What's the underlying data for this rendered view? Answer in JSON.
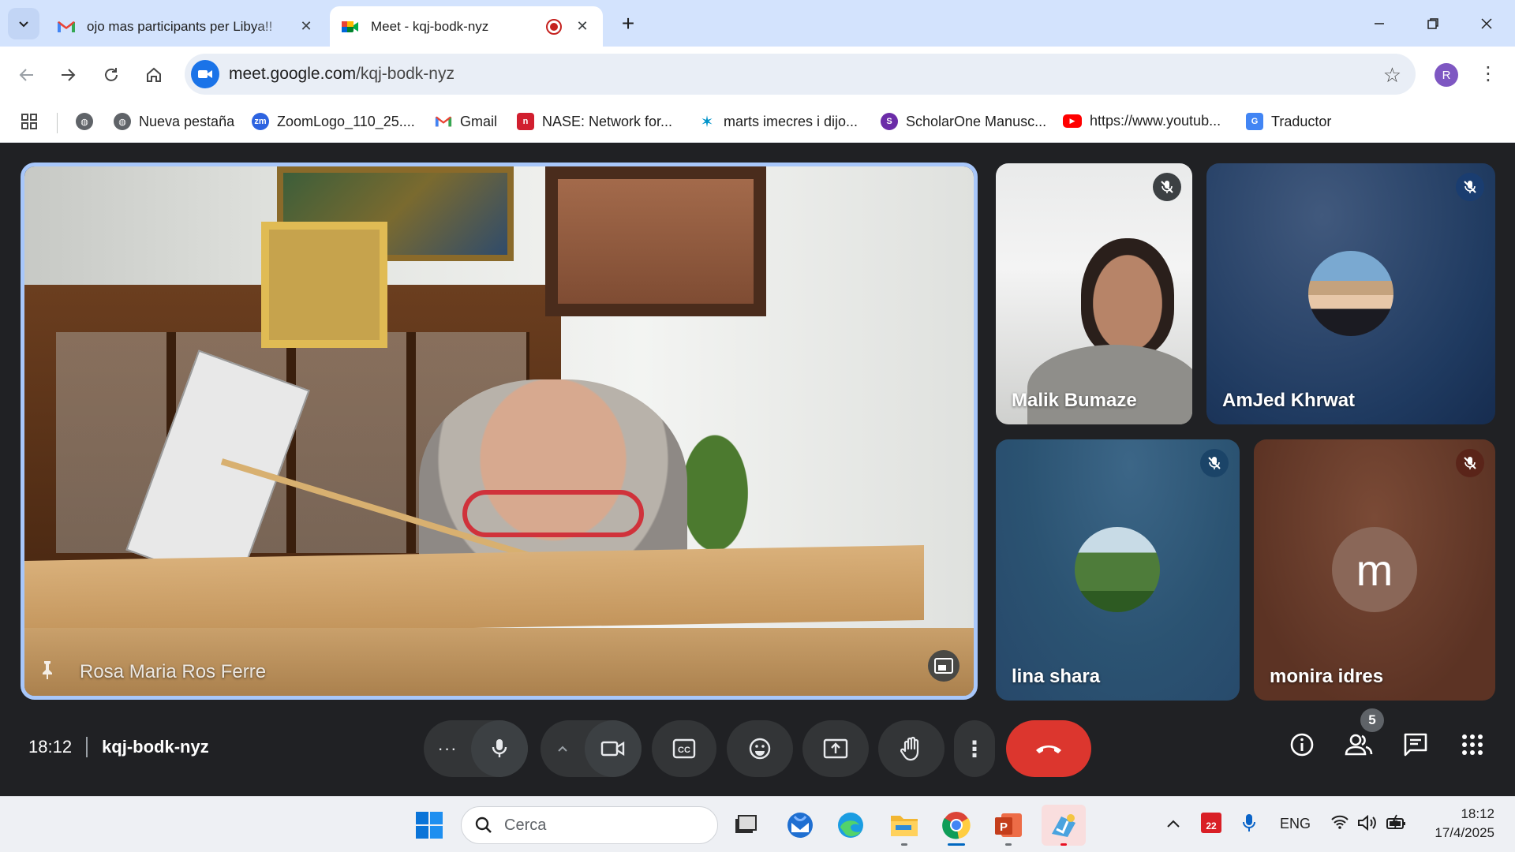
{
  "browser": {
    "tabs": [
      {
        "title": "ojo mas participants per Libya!!",
        "icon": "gmail-icon",
        "active": false
      },
      {
        "title": "Meet - kqj-bodk-nyz",
        "icon": "meet-icon",
        "active": true,
        "recording": true
      }
    ],
    "url_host": "meet.google.com",
    "url_path": "/kqj-bodk-nyz",
    "profile_initial": "R",
    "bookmarks": [
      {
        "label": "Nueva pestaña",
        "icon": "globe-icon"
      },
      {
        "label": "ZoomLogo_110_25....",
        "icon": "zoom-icon"
      },
      {
        "label": "Gmail",
        "icon": "gmail-icon"
      },
      {
        "label": "NASE: Network for...",
        "icon": "nase-icon"
      },
      {
        "label": "marts imecres i dijo...",
        "icon": "caixabank-icon"
      },
      {
        "label": "ScholarOne Manusc...",
        "icon": "scholarone-icon"
      },
      {
        "label": "https://www.youtub...",
        "icon": "youtube-icon"
      },
      {
        "label": "Traductor",
        "icon": "translate-icon"
      }
    ]
  },
  "meet": {
    "presenter": {
      "name": "Rosa Maria Ros Ferre",
      "pinned": true
    },
    "participants": [
      {
        "name": "Malik Bumaze",
        "muted": true,
        "video": true
      },
      {
        "name": "AmJed Khrwat",
        "muted": true,
        "video": false
      },
      {
        "name": "lina shara",
        "muted": true,
        "video": false
      },
      {
        "name": "monira idres",
        "muted": true,
        "video": false,
        "initial": "m"
      }
    ],
    "time": "18:12",
    "meeting_code": "kqj-bodk-nyz",
    "participant_count": "5"
  },
  "taskbar": {
    "search_placeholder": "Cerca",
    "language": "ENG",
    "calendar_day": "22",
    "clock_time": "18:12",
    "clock_date": "17/4/2025"
  },
  "colors": {
    "meet_bg": "#202124",
    "active_tile_border": "#a8c7fa",
    "hangup_red": "#dc362e",
    "tab_strip": "#d3e3fd"
  }
}
